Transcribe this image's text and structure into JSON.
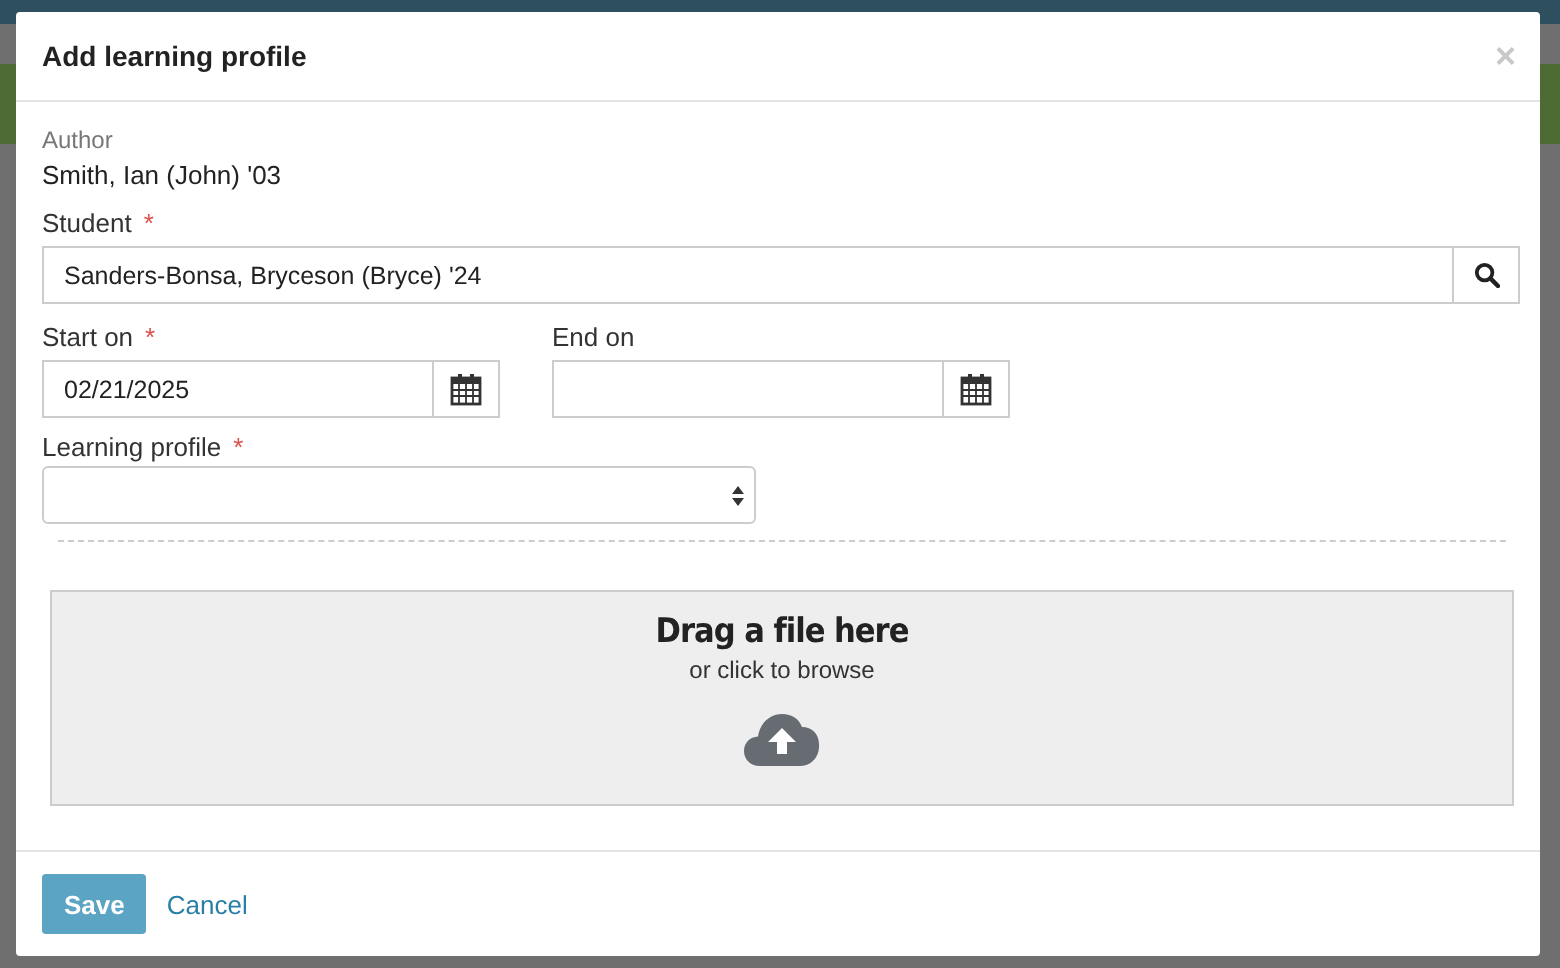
{
  "dialog": {
    "title": "Add learning profile",
    "close": "×"
  },
  "required_mark": "*",
  "author": {
    "label": "Author",
    "value": "Smith, Ian (John) '03"
  },
  "student": {
    "label": "Student",
    "required": true,
    "value": "Sanders-Bonsa, Bryceson (Bryce) '24"
  },
  "dates": [
    {
      "label": "Start on",
      "required": true,
      "value": "02/21/2025"
    },
    {
      "label": "End on",
      "required": false
    }
  ],
  "learning_profile": {
    "label": "Learning profile",
    "required": true
  },
  "dropzone": {
    "title": "Drag a file here",
    "subtitle": "or click to browse"
  },
  "buttons": [
    {
      "label": "Save",
      "kind": "primary"
    },
    {
      "label": "Cancel",
      "kind": "link"
    }
  ]
}
